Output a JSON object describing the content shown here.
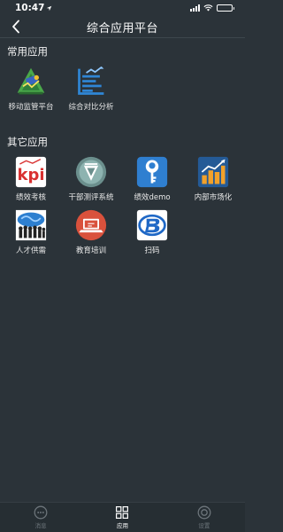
{
  "status": {
    "time": "10:47"
  },
  "nav": {
    "title": "综合应用平台"
  },
  "sections": {
    "common": {
      "title": "常用应用",
      "apps": [
        {
          "label": "移动监管平台",
          "icon": "mobile-supervision-icon"
        },
        {
          "label": "综合对比分析",
          "icon": "comparison-chart-icon"
        }
      ]
    },
    "other": {
      "title": "其它应用",
      "apps": [
        {
          "label": "绩效考核",
          "icon": "kpi-icon"
        },
        {
          "label": "干部测评系统",
          "icon": "cadre-evaluation-icon"
        },
        {
          "label": "绩效demo",
          "icon": "key-icon"
        },
        {
          "label": "内部市场化",
          "icon": "bar-chart-icon"
        },
        {
          "label": "人才供需",
          "icon": "talent-crowd-icon"
        },
        {
          "label": "教育培训",
          "icon": "laptop-training-icon"
        },
        {
          "label": "扫码",
          "icon": "scan-logo-icon"
        }
      ]
    }
  },
  "tabs": [
    {
      "label": "消息",
      "icon": "chat-icon",
      "active": false
    },
    {
      "label": "应用",
      "icon": "grid-icon",
      "active": true
    },
    {
      "label": "设置",
      "icon": "settings-icon",
      "active": false
    }
  ],
  "colors": {
    "background": "#2b3339",
    "tabbar": "#262e33",
    "active": "#ffffff",
    "inactive": "#6d757b"
  }
}
